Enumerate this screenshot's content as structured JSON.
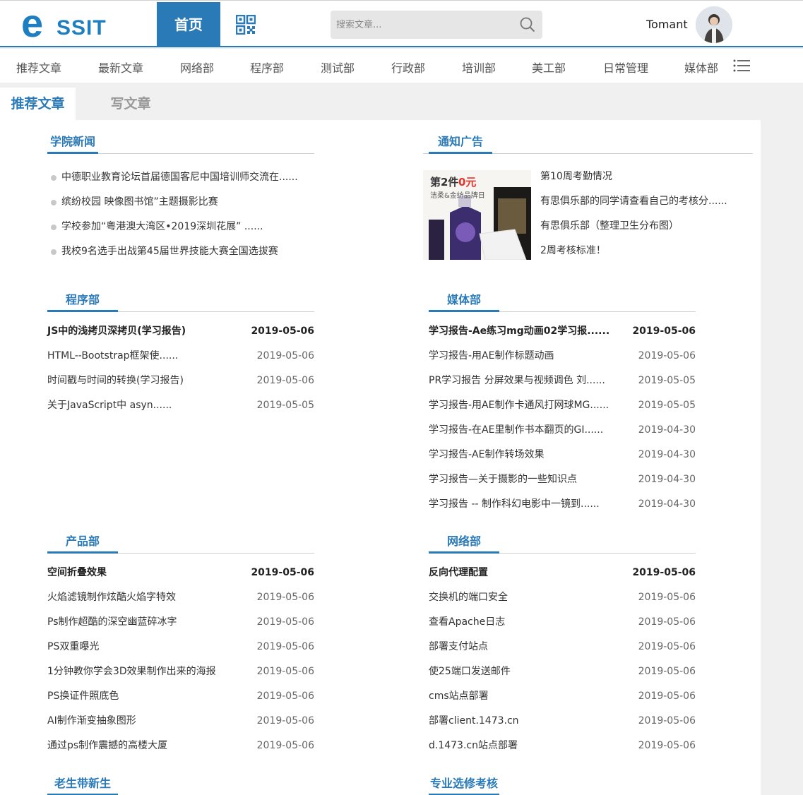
{
  "header": {
    "logo_text": "SSIT",
    "home_label": "首页",
    "search_placeholder": "搜索文章...",
    "username": "Tomant"
  },
  "categories": [
    "推荐文章",
    "最新文章",
    "网络部",
    "程序部",
    "测试部",
    "行政部",
    "培训部",
    "美工部",
    "日常管理",
    "媒体部"
  ],
  "tabs": {
    "active": "推荐文章",
    "write": "写文章"
  },
  "college_news": {
    "title": "学院新闻",
    "items": [
      "中德职业教育论坛首届德国客尼中国培训师交流在......",
      "缤纷校园 映像图书馆”主题摄影比赛",
      "学校参加“粤港澳大湾区•2019深圳花展”  ......",
      "我校9名选手出战第45届世界技能大赛全国选拔赛"
    ]
  },
  "notice": {
    "title": "通知广告",
    "ad_text_1": "第2件",
    "ad_text_2": "0元",
    "ad_text_3": "洁柔&金纺品牌日",
    "items": [
      "第10周考勤情况",
      "有思俱乐部的同学请查看自己的考核分......",
      "有思俱乐部（整理卫生分布图）",
      "2周考核标准！"
    ]
  },
  "program": {
    "title": "程序部",
    "articles": [
      {
        "title": "JS中的浅拷贝深拷贝(学习报告)",
        "date": "2019-05-06"
      },
      {
        "title": "HTML--Bootstrap框架使......",
        "date": "2019-05-06"
      },
      {
        "title": "时间戳与时间的转换(学习报告)",
        "date": "2019-05-06"
      },
      {
        "title": "关于JavaScript中 asyn......",
        "date": "2019-05-05"
      }
    ]
  },
  "media": {
    "title": "媒体部",
    "articles": [
      {
        "title": "学习报告-Ae练习mg动画02学习报......",
        "date": "2019-05-06"
      },
      {
        "title": "学习报告-用AE制作标题动画",
        "date": "2019-05-06"
      },
      {
        "title": "PR学习报告 分屏效果与视频调色 刘......",
        "date": "2019-05-05"
      },
      {
        "title": "学习报告-用AE制作卡通风打网球MG......",
        "date": "2019-05-05"
      },
      {
        "title": "学习报告-在AE里制作书本翻页的GI......",
        "date": "2019-04-30"
      },
      {
        "title": "学习报告-AE制作转场效果",
        "date": "2019-04-30"
      },
      {
        "title": "学习报告—关于摄影的一些知识点",
        "date": "2019-04-30"
      },
      {
        "title": "学习报告 -- 制作科幻电影中一镜到......",
        "date": "2019-04-30"
      }
    ]
  },
  "product": {
    "title": "产品部",
    "articles": [
      {
        "title": "空间折叠效果",
        "date": "2019-05-06"
      },
      {
        "title": "火焰滤镜制作炫酷火焰字特效",
        "date": "2019-05-06"
      },
      {
        "title": "Ps制作超酷的深空幽蓝碎冰字",
        "date": "2019-05-06"
      },
      {
        "title": "PS双重曝光",
        "date": "2019-05-06"
      },
      {
        "title": "1分钟教你学会3D效果制作出来的海报",
        "date": "2019-05-06"
      },
      {
        "title": "PS换证件照底色",
        "date": "2019-05-06"
      },
      {
        "title": "AI制作渐变抽象图形",
        "date": "2019-05-06"
      },
      {
        "title": "通过ps制作震撼的高楼大厦",
        "date": "2019-05-06"
      }
    ]
  },
  "network": {
    "title": "网络部",
    "articles": [
      {
        "title": "反向代理配置",
        "date": "2019-05-06"
      },
      {
        "title": "交换机的端口安全",
        "date": "2019-05-06"
      },
      {
        "title": "查看Apache日志",
        "date": "2019-05-06"
      },
      {
        "title": "部署支付站点",
        "date": "2019-05-06"
      },
      {
        "title": "使25端口发送邮件",
        "date": "2019-05-06"
      },
      {
        "title": "cms站点部署",
        "date": "2019-05-06"
      },
      {
        "title": "部署client.1473.cn",
        "date": "2019-05-06"
      },
      {
        "title": "d.1473.cn站点部署",
        "date": "2019-05-06"
      }
    ]
  },
  "mentor": {
    "title": "老生带新生"
  },
  "elective": {
    "title": "专业选修考核"
  },
  "colors": {
    "brand": "#2b7ab8",
    "logo": "#1d7fc1"
  }
}
